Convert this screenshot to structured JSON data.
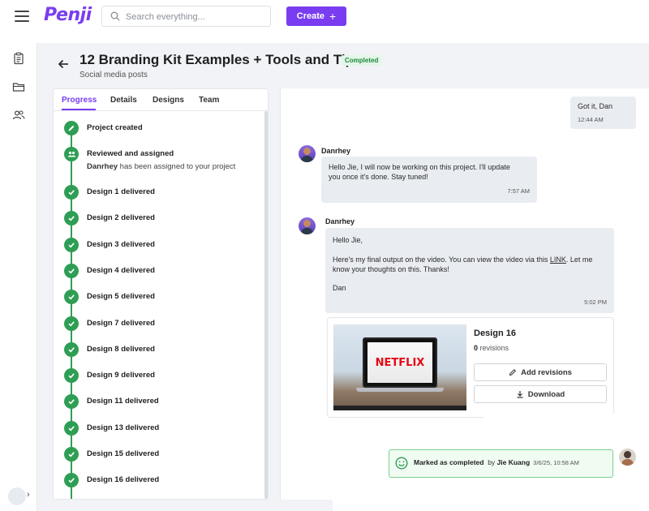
{
  "app": {
    "logo": "Penji"
  },
  "header": {
    "search_placeholder": "Search everything...",
    "create_label": "Create",
    "create_icon": "plus-icon"
  },
  "rail": {
    "icons": [
      "clipboard-icon",
      "folder-icon",
      "users-icon"
    ],
    "expand_icon": "chevron-right-icon"
  },
  "project": {
    "title": "12 Branding Kit Examples + Tools and Tips",
    "status": "Completed",
    "subtitle": "Social media posts"
  },
  "tabs": [
    "Progress",
    "Details",
    "Designs",
    "Team"
  ],
  "active_tab": "Progress",
  "timeline": [
    {
      "label": "Project created",
      "icon": "pencil-icon"
    },
    {
      "label": "Reviewed and assigned",
      "icon": "group-icon",
      "sub_name": "Danrhey",
      "sub_text": " has been assigned to your project"
    },
    {
      "label": "Design 1 delivered",
      "icon": "check-icon"
    },
    {
      "label": "Design 2 delivered",
      "icon": "check-icon"
    },
    {
      "label": "Design 3 delivered",
      "icon": "check-icon"
    },
    {
      "label": "Design 4 delivered",
      "icon": "check-icon"
    },
    {
      "label": "Design 5 delivered",
      "icon": "check-icon"
    },
    {
      "label": "Design 7 delivered",
      "icon": "check-icon"
    },
    {
      "label": "Design 8 delivered",
      "icon": "check-icon"
    },
    {
      "label": "Design 9 delivered",
      "icon": "check-icon"
    },
    {
      "label": "Design 11 delivered",
      "icon": "check-icon"
    },
    {
      "label": "Design 13 delivered",
      "icon": "check-icon"
    },
    {
      "label": "Design 15 delivered",
      "icon": "check-icon"
    },
    {
      "label": "Design 16 delivered",
      "icon": "check-icon"
    }
  ],
  "chat": {
    "msg1": {
      "text": "Got it, Dan",
      "time": "12:44 AM"
    },
    "msg2": {
      "sender": "Danrhey",
      "line1": "Hello Jie, I will now be working on this project. I'll update",
      "line2": "you once it's done. Stay tuned!",
      "time": "7:57 AM"
    },
    "msg3": {
      "sender": "Danrhey",
      "greeting": "Hello Jie,",
      "line1_pre": "Here's my final output on the video. You can view the video via this ",
      "link": "LINK",
      "line1_post": ". Let me",
      "line2": "know your thoughts on this. Thanks!",
      "signoff": "Dan",
      "time": "5:02 PM"
    },
    "design_card": {
      "thumbnail_text": "NETFLIX",
      "title": "Design 16",
      "revisions_count": "0",
      "revisions_label": " revisions",
      "add_revisions_label": "Add revisions",
      "download_label": "Download"
    },
    "completed": {
      "label": "Marked as completed",
      "by": "by",
      "user": "Jie Kuang",
      "time": "3/6/25, 10:58 AM"
    }
  },
  "colors": {
    "accent": "#7a3cf0",
    "success": "#2f9e55"
  }
}
